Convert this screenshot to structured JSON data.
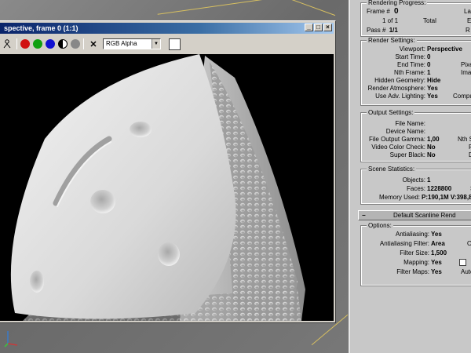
{
  "frame_window": {
    "title": "spective, frame 0 (1:1)",
    "buttons": [
      "_",
      "□",
      "×"
    ],
    "channel": "RGB Alpha",
    "toolbar_icons": [
      "save-icon",
      "red-channel-icon",
      "green-channel-icon",
      "blue-channel-icon",
      "alpha-display-icon",
      "mono-icon",
      "clear-icon"
    ],
    "colors": {
      "red": "#d01010",
      "green": "#10a010",
      "blue": "#1010d0",
      "title": "#0a246a"
    }
  },
  "progress": {
    "title": "Rendering Progress:",
    "frame_label": "Frame #",
    "frame_value": "0",
    "last_label": "Last",
    "of_value": "1 of 1",
    "total_label": "Total",
    "e_label": "E",
    "pass_label": "Pass #",
    "pass_value": "1/1",
    "r_label": "R"
  },
  "render_settings": {
    "title": "Render Settings:",
    "rows": [
      {
        "label": "Viewport:",
        "value": "Perspective"
      },
      {
        "label": "Start Time:",
        "value": "0"
      },
      {
        "label": "End Time:",
        "value": "0"
      },
      {
        "label": "Nth Frame:",
        "value": "1"
      },
      {
        "label": "Hidden Geometry:",
        "value": "Hide"
      },
      {
        "label": "Render Atmosphere:",
        "value": "Yes"
      },
      {
        "label": "Use Adv. Lighting:",
        "value": "Yes"
      }
    ],
    "right_labels": [
      "Pixe",
      "Imag",
      "R",
      "R",
      "Compute"
    ]
  },
  "output_settings": {
    "title": "Output Settings:",
    "rows": [
      {
        "label": "File Name:",
        "value": ""
      },
      {
        "label": "Device Name:",
        "value": ""
      },
      {
        "label": "File Output Gamma:",
        "value": "1,00"
      },
      {
        "label": "Video Color Check:",
        "value": "No"
      },
      {
        "label": "Super Black:",
        "value": "No"
      }
    ],
    "right_labels": [
      "Nth Se",
      "Re",
      "Di"
    ]
  },
  "scene_stats": {
    "title": "Scene Statistics:",
    "objects_label": "Objects:",
    "objects_value": "1",
    "faces_label": "Faces:",
    "faces_value": "1228800",
    "s_label": "S",
    "memory_label": "Memory Used:",
    "memory_value": "P:190,1M V:398,8M"
  },
  "rollout": {
    "minus": "−",
    "title": "Default Scanline Rend"
  },
  "options": {
    "title": "Options:",
    "antialiasing_label": "Antialiasing:",
    "antialiasing_value": "Yes",
    "filter_label": "Antialiasing Filter:",
    "filter_value": "Area",
    "filter_size_label": "Filter Size:",
    "filter_size_value": "1,500",
    "mapping_label": "Mapping:",
    "mapping_value": "Yes",
    "filter_maps_label": "Filter Maps:",
    "filter_maps_value": "Yes",
    "right_labels": [
      "O",
      "In",
      "Auto"
    ]
  }
}
